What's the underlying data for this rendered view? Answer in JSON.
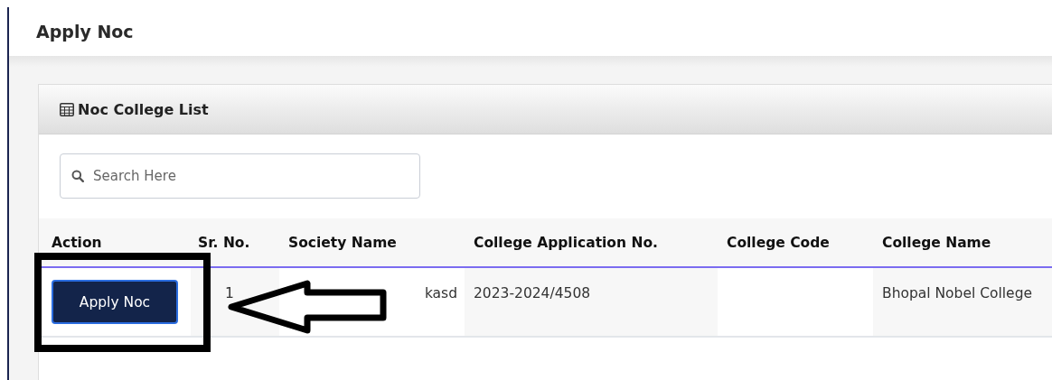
{
  "page_title": "Apply Noc",
  "card": {
    "title": "Noc College List",
    "search": {
      "placeholder": "Search Here"
    },
    "table": {
      "columns": [
        "Action",
        "Sr. No.",
        "Society Name",
        "College Application No.",
        "College Code",
        "College Name"
      ],
      "rows": [
        {
          "action": "Apply Noc",
          "sr_no": "1",
          "society_name": "kasd",
          "application_no": "2023-2024/4508",
          "college_code": "",
          "college_name": "Bhopal Nobel College"
        }
      ]
    }
  }
}
